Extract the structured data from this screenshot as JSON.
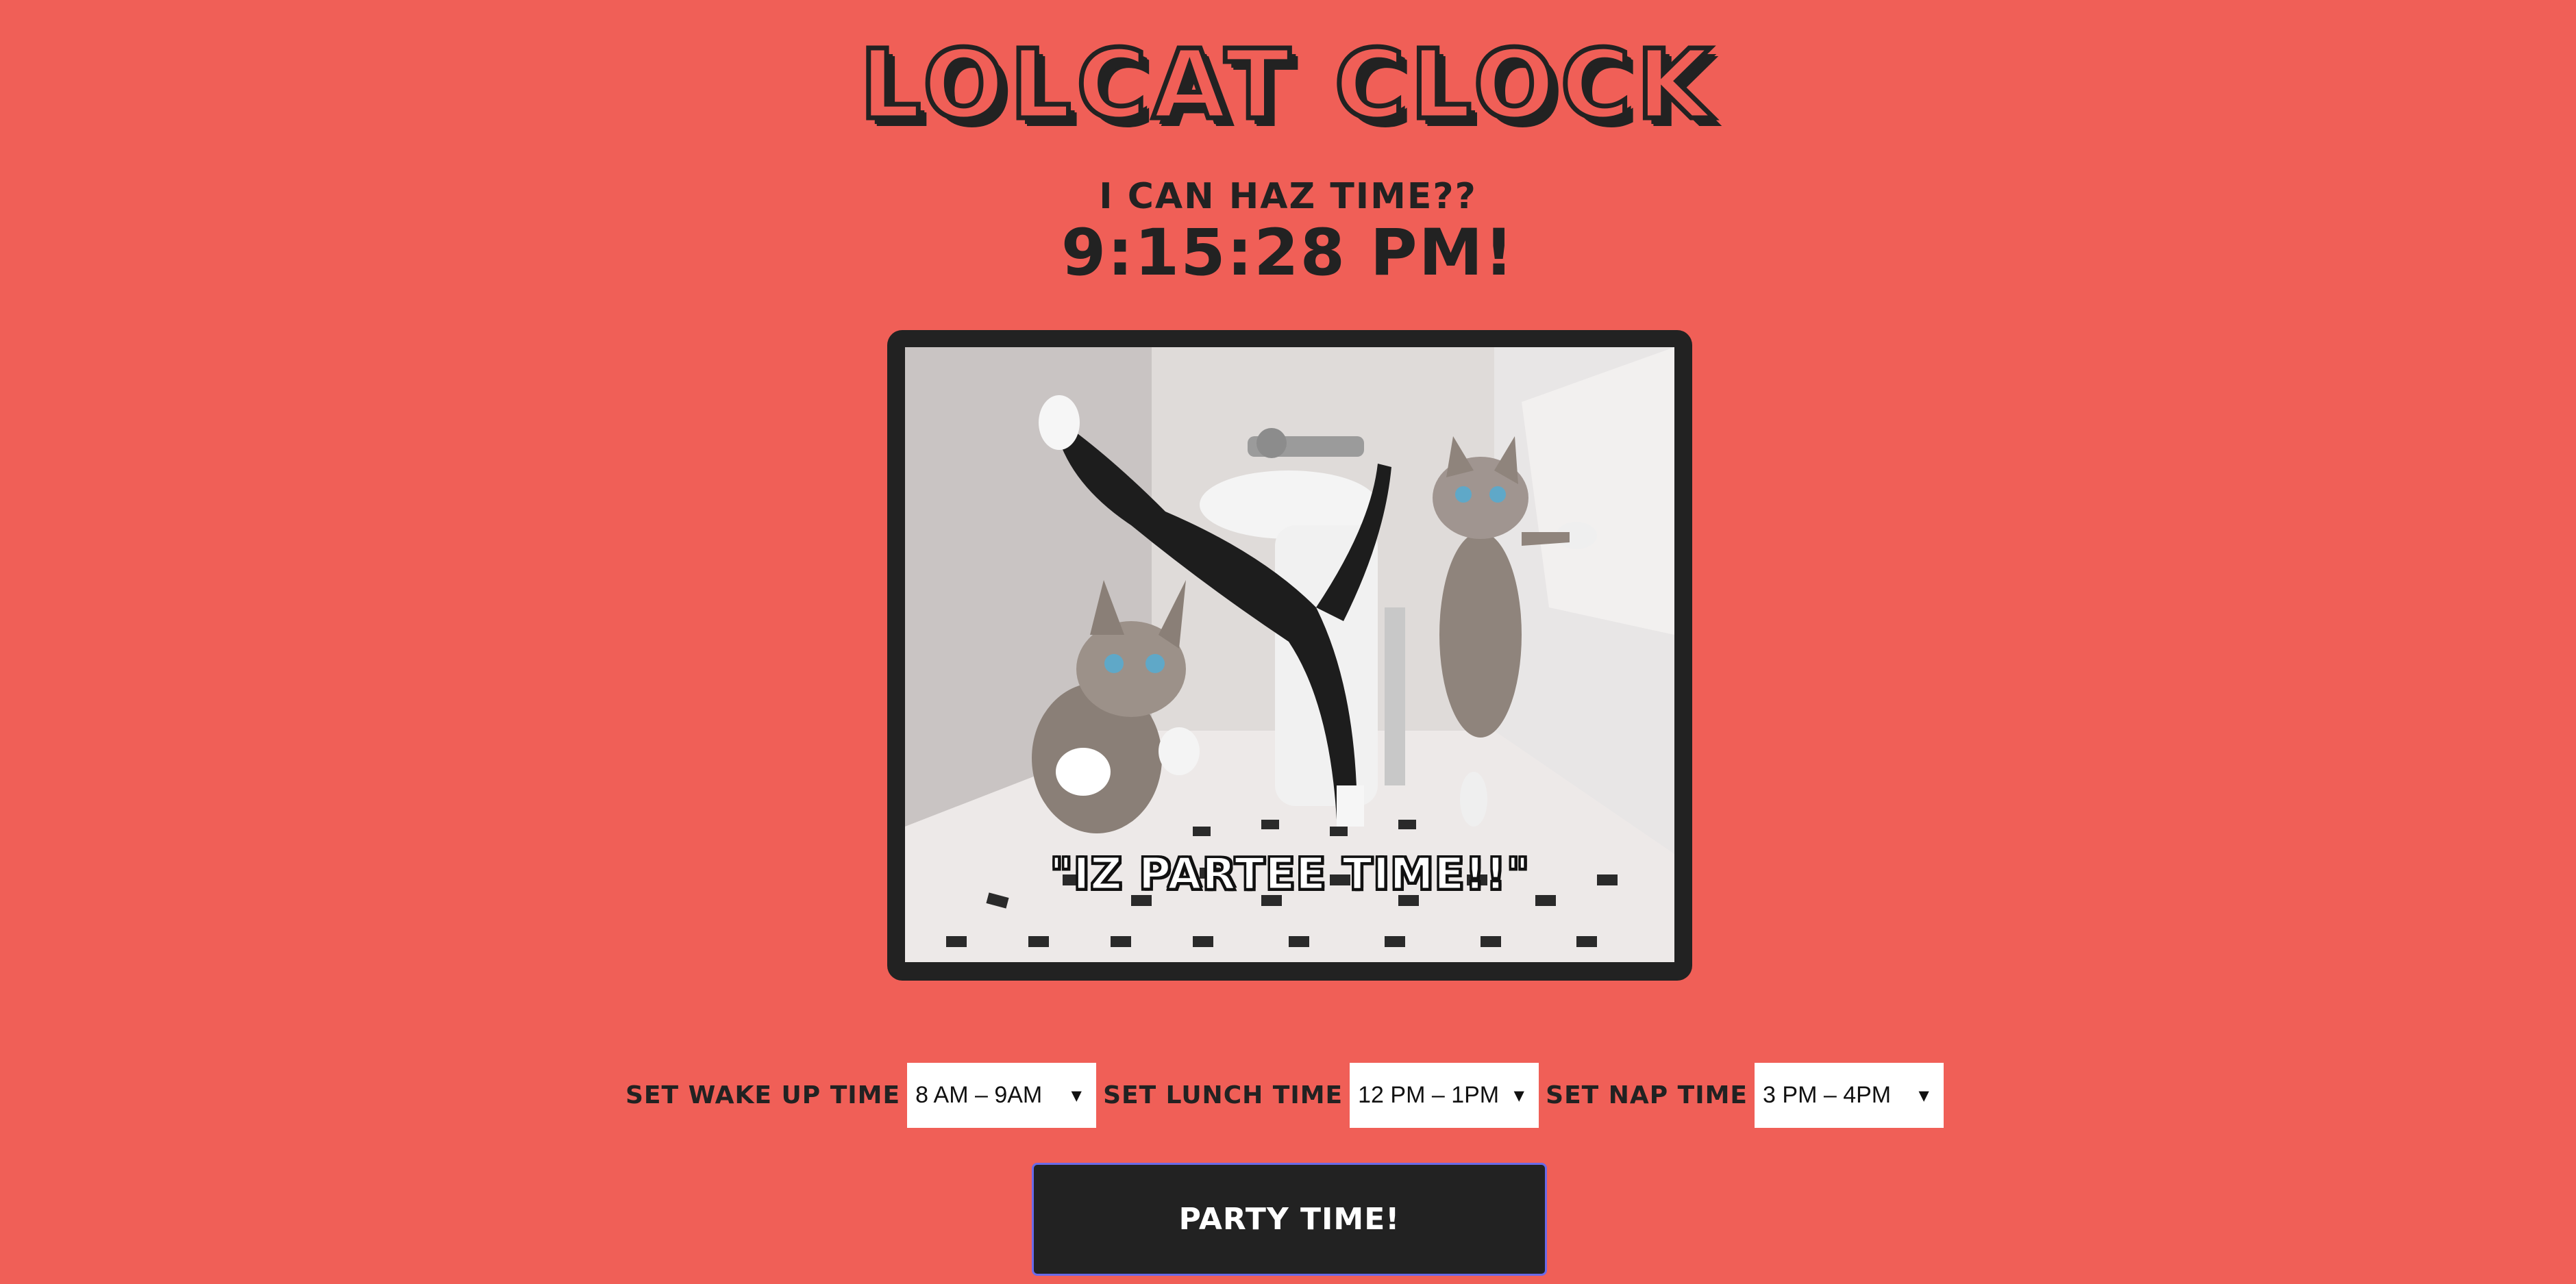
{
  "header": {
    "title": "LOLCAT CLOCK",
    "subtitle": "I CAN HAZ TIME??",
    "time": "9:15:28 PM!"
  },
  "image": {
    "caption": "\"IZ PARTEE TIME!!\"",
    "description_icon": "kittens-photo"
  },
  "controls": {
    "wake_up": {
      "label": "SET WAKE UP TIME",
      "selected": "8 AM – 9AM"
    },
    "lunch": {
      "label": "SET LUNCH TIME",
      "selected": "12 PM – 1PM"
    },
    "nap": {
      "label": "SET NAP TIME",
      "selected": "3 PM – 4PM"
    }
  },
  "actions": {
    "party_button": "PARTY TIME!"
  },
  "colors": {
    "background": "#f05f57",
    "dark": "#222222",
    "button_border": "#6a6ae8"
  }
}
